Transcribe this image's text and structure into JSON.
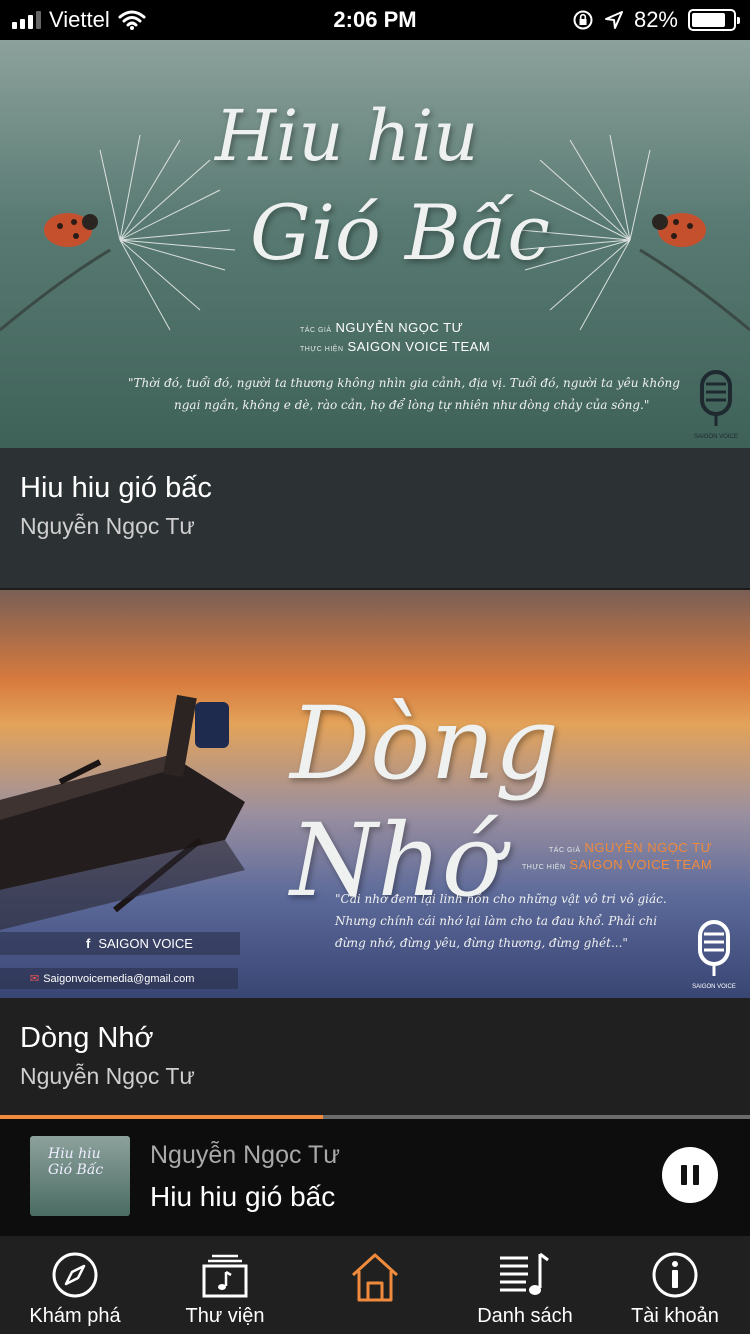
{
  "status_bar": {
    "carrier": "Viettel",
    "time": "2:06 PM",
    "battery": "82%",
    "battery_level": 0.82
  },
  "feed": [
    {
      "title": "Hiu hiu gió bấc",
      "author": "Nguyễn Ngọc Tư",
      "cover": {
        "title_line1": "Hiu hiu",
        "title_line2": "Gió Bấc",
        "author_label": "TÁC GIẢ",
        "author": "NGUYỄN NGỌC TƯ",
        "producer_label": "THỰC HIỆN",
        "producer": "SAIGON VOICE TEAM",
        "quote_line1": "\"Thời đó, tuổi đó, người ta thương không nhìn gia cảnh, địa vị. Tuổi đó, người ta yêu không",
        "quote_line2": "ngại ngần, không e dè, rào cản, họ để lòng tự nhiên như dòng chảy của sông.\"",
        "logo_text": "SAIGON VOICE"
      }
    },
    {
      "title": "Dòng Nhớ",
      "author": "Nguyễn Ngọc Tư",
      "cover": {
        "title": "Dòng Nhớ",
        "author_label": "TÁC GIẢ",
        "author": "NGUYỄN NGỌC TƯ",
        "producer_label": "THỰC HIỆN",
        "producer": "SAIGON VOICE TEAM",
        "quote_line1": "\"Cái nhớ đem lại linh hồn cho những vật vô tri vô giác.",
        "quote_line2": "Nhưng chính cái nhớ lại làm cho ta đau khổ. Phải chi",
        "quote_line3": "đừng nhớ, đừng yêu, đừng thương, đừng ghét...\"",
        "facebook": "SAIGON VOICE",
        "email": "Saigonvoicemedia@gmail.com",
        "logo_text": "SAIGON VOICE"
      }
    }
  ],
  "player": {
    "author": "Nguyễn Ngọc Tư",
    "title": "Hiu hiu gió bấc",
    "thumb_text": "Hiu hiu Gió Bấc",
    "progress": 0.43,
    "accent": "#f08a3c"
  },
  "tabs": [
    {
      "label": "Khám phá",
      "icon": "compass-icon"
    },
    {
      "label": "Thư viện",
      "icon": "library-music-icon"
    },
    {
      "label": "",
      "icon": "home-icon",
      "active": true
    },
    {
      "label": "Danh sách",
      "icon": "playlist-icon"
    },
    {
      "label": "Tài khoản",
      "icon": "info-icon"
    }
  ]
}
